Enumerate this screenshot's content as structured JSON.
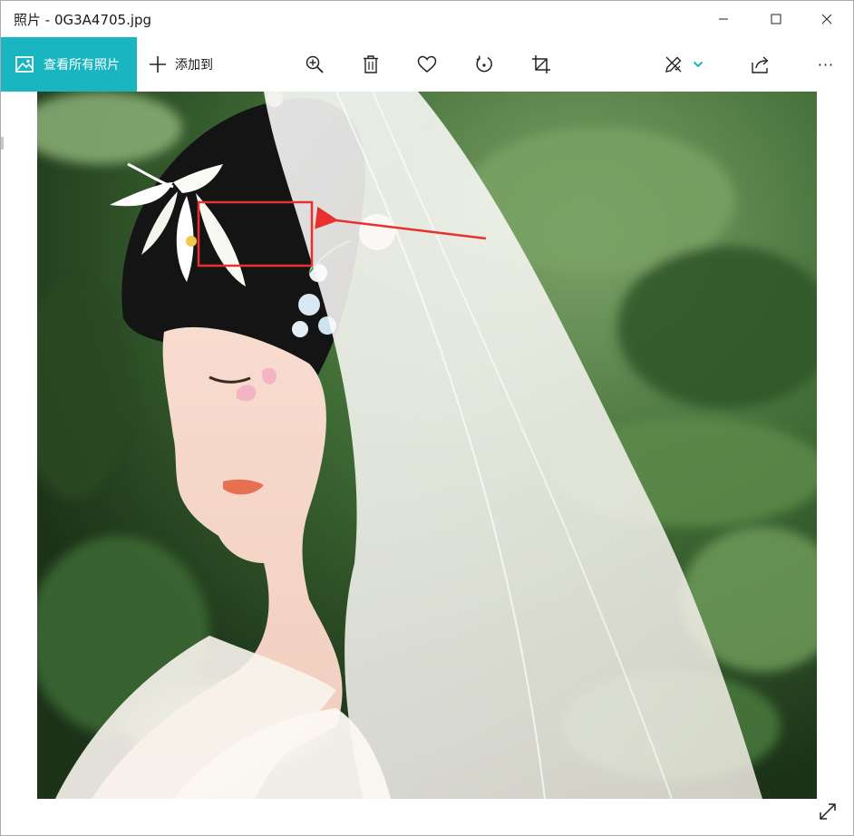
{
  "window": {
    "title": "照片 - 0G3A4705.jpg"
  },
  "toolbar": {
    "see_all_label": "查看所有照片",
    "add_to_label": "添加到",
    "more_label": "···"
  },
  "icons": {
    "see_all": "photo-icon",
    "add": "plus-icon",
    "zoom": "zoom-in-icon",
    "delete": "trash-icon",
    "favorite": "heart-icon",
    "rotate": "rotate-icon",
    "crop": "crop-icon",
    "edit": "edit-pen-icon",
    "edit_dropdown": "chevron-down-icon",
    "share": "share-icon",
    "more": "more-icon",
    "expand": "expand-icon"
  },
  "colors": {
    "accent": "#19b5c0",
    "annotation": "#e8312f"
  }
}
